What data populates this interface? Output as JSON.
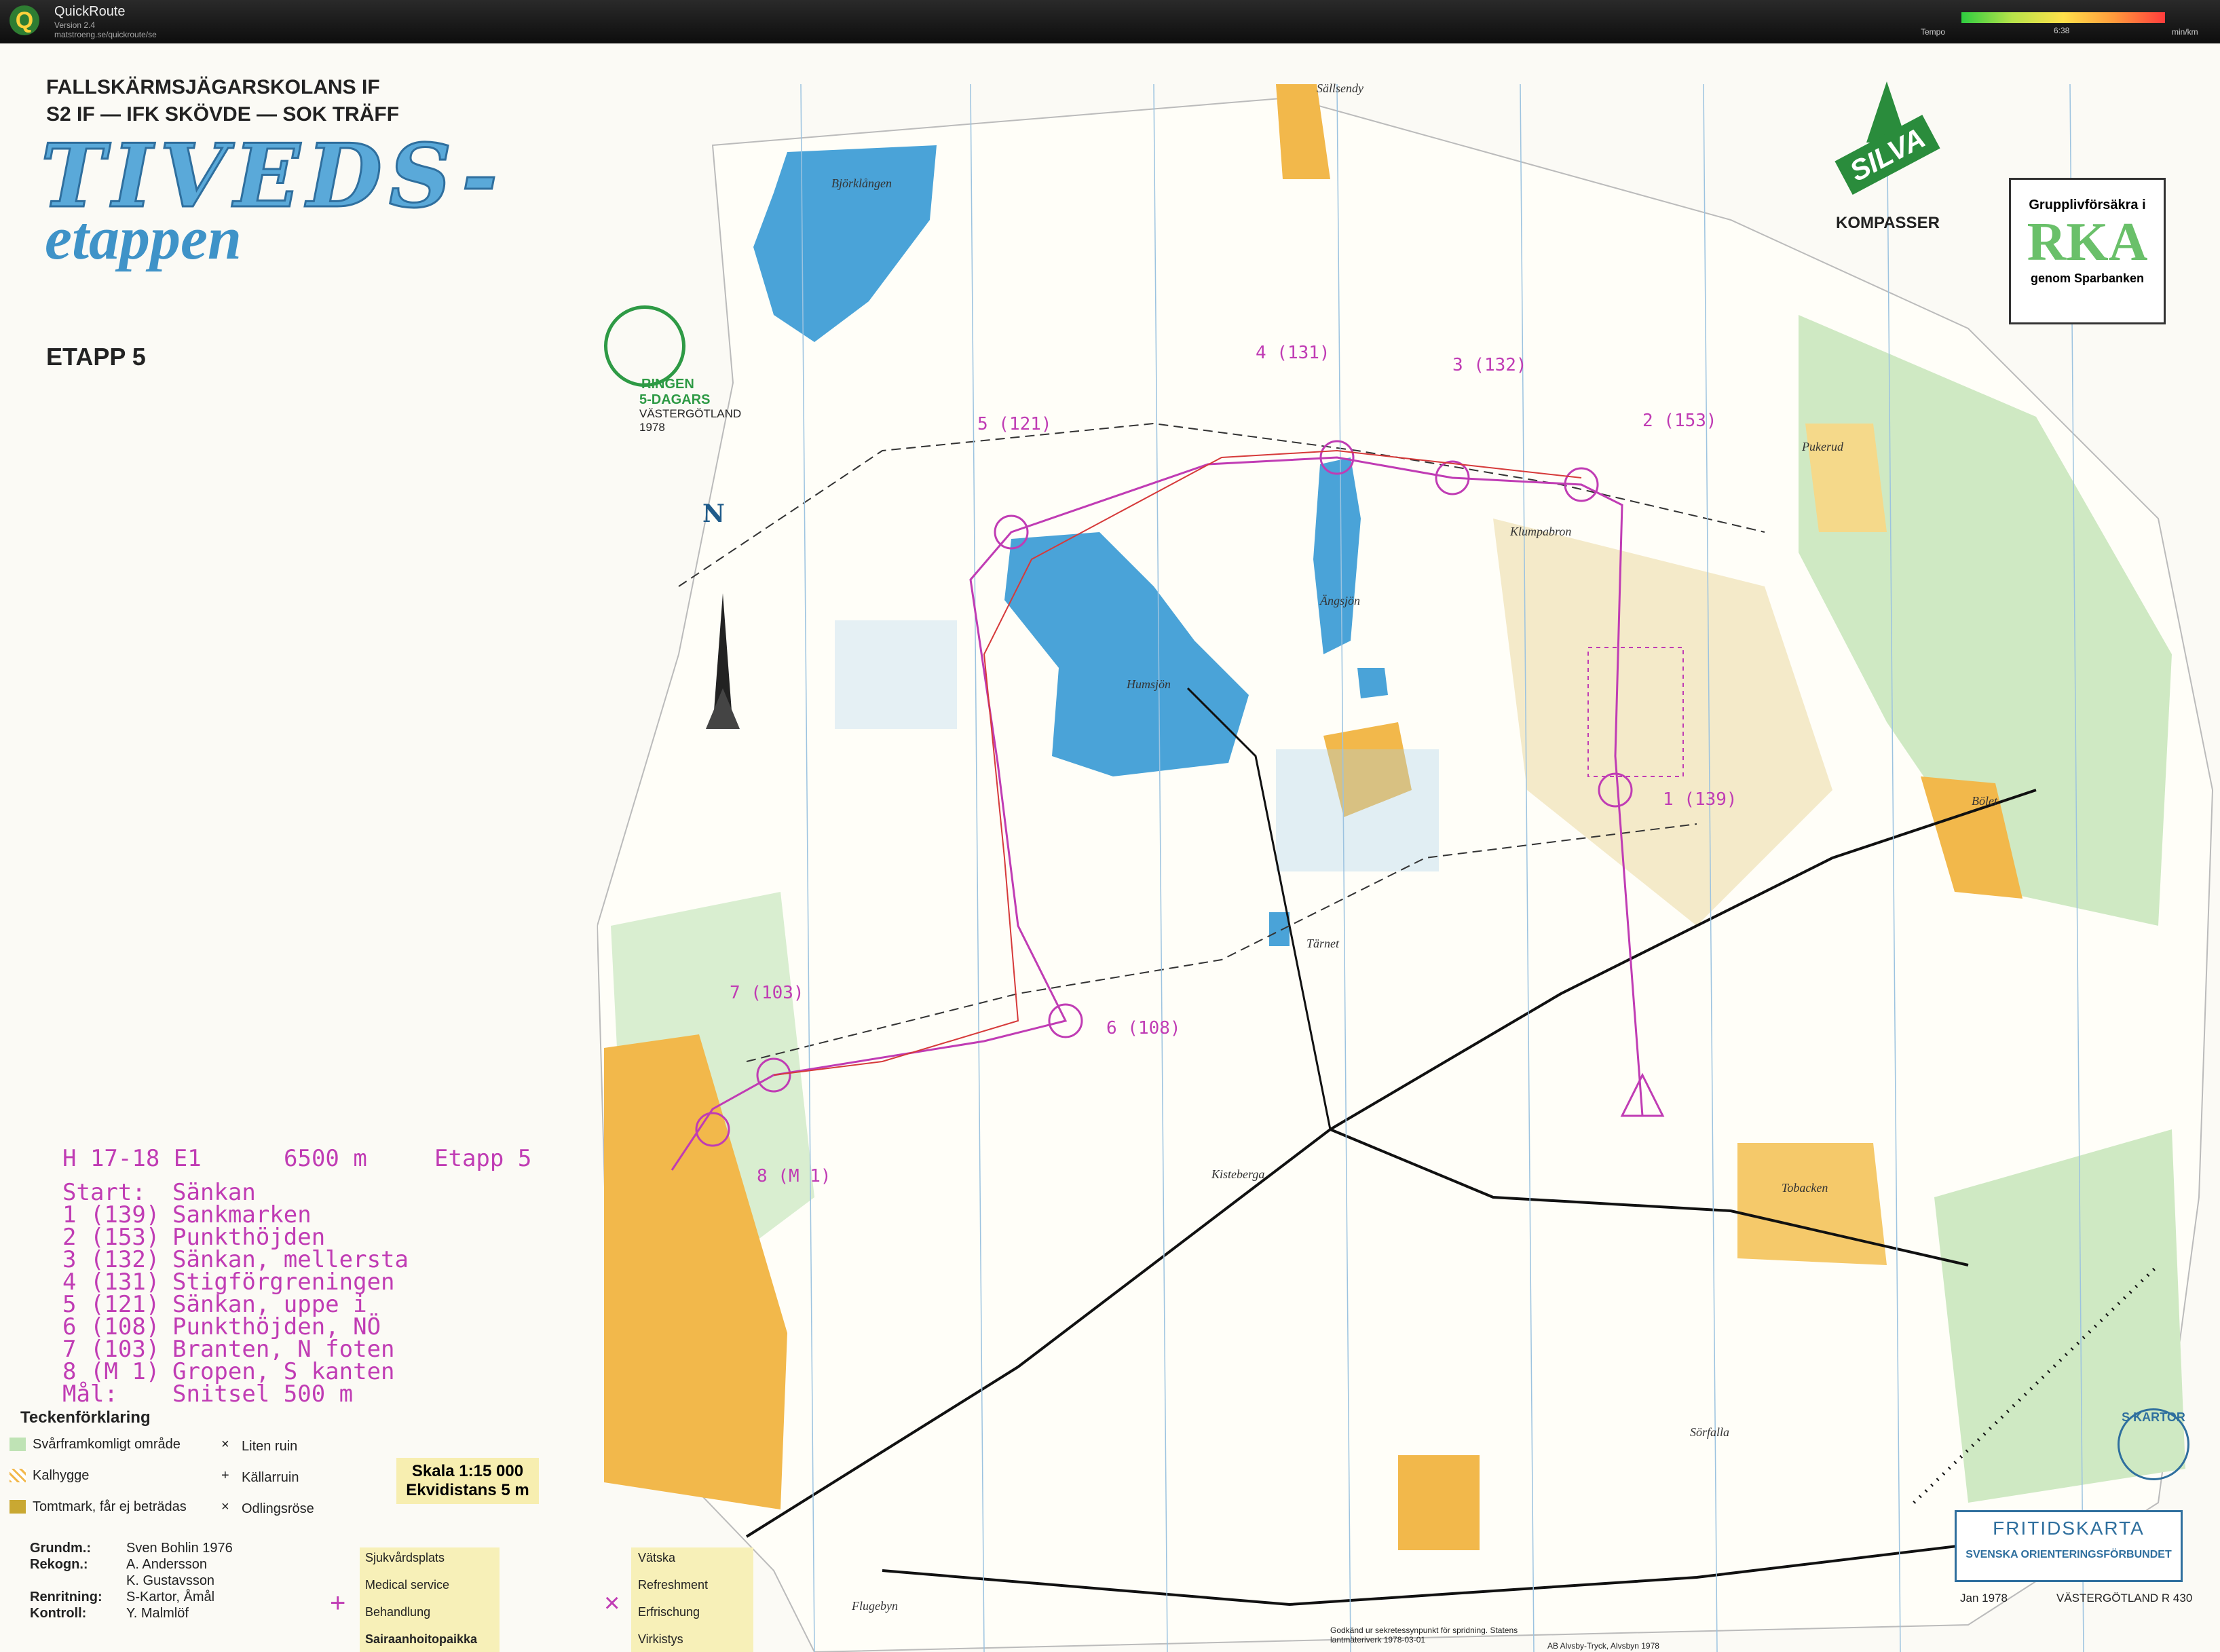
{
  "app": {
    "name": "QuickRoute",
    "version": "Version 2.4",
    "url": "matstroeng.se/quickroute/se"
  },
  "tempo": {
    "label": "Tempo",
    "value": "6:38",
    "unit": "min/km"
  },
  "header": {
    "club_line1": "FALLSKÄRMSJÄGARSKOLANS IF",
    "club_line2": "S2 IF — IFK SKÖVDE — SOK TRÄFF",
    "title": "TIVEDS-",
    "subtitle": "etappen",
    "stage": "ETAPP 5",
    "ringen_line1": "RINGEN",
    "ringen_line2": "5-DAGARS",
    "ringen_line3": "VÄSTERGÖTLAND",
    "ringen_line4": "1978"
  },
  "sponsors": {
    "silva": "SILVA",
    "kompasser": "KOMPASSER",
    "rka_line1": "Grupplivförsäkra i",
    "rka_big": "RKA",
    "rka_line3": "genom Sparbanken"
  },
  "north": "N",
  "course": {
    "header_class": "H 17-18 E1",
    "header_length": "6500 m",
    "header_stage": "Etapp 5",
    "lines": [
      {
        "num": "Start:",
        "desc": "Sänkan"
      },
      {
        "num": "1 (139)",
        "desc": "Sankmarken"
      },
      {
        "num": "2 (153)",
        "desc": "Punkthöjden"
      },
      {
        "num": "3 (132)",
        "desc": "Sänkan, mellersta"
      },
      {
        "num": "4 (131)",
        "desc": "Stigförgreningen"
      },
      {
        "num": "5 (121)",
        "desc": "Sänkan, uppe i"
      },
      {
        "num": "6 (108)",
        "desc": "Punkthöjden, NÖ"
      },
      {
        "num": "7 (103)",
        "desc": "Branten, N foten"
      },
      {
        "num": "8 (M 1)",
        "desc": "Gropen, S kanten"
      },
      {
        "num": "Mål:",
        "desc": "Snitsel 500 m"
      }
    ]
  },
  "map_labels": {
    "bjorklangen": "Björklången",
    "sallsendy": "Sällsendy",
    "humsjon": "Humsjön",
    "angsjon": "Ängsjön",
    "klumpabron": "Klumpabron",
    "pukerud": "Pukerud",
    "bolet": "Bölet",
    "tarnet": "Tärnet",
    "kisteberga": "Kisteberga",
    "tobacken": "Tobacken",
    "sorfalla": "Sörfalla",
    "flugebyn": "Flugebyn"
  },
  "controls": {
    "c1": "1 (139)",
    "c2": "2 (153)",
    "c3": "3 (132)",
    "c4": "4 (131)",
    "c5": "5 (121)",
    "c6": "6 (108)",
    "c7": "7 (103)",
    "c8": "8 (M 1)"
  },
  "legend": {
    "title": "Teckenförklaring",
    "items": [
      "Svårframkomligt område",
      "Kalhygge",
      "Tomtmark, får ej beträdas"
    ],
    "items_right": [
      "Liten ruin",
      "Källarruin",
      "Odlingsröse"
    ]
  },
  "scale": {
    "line1": "Skala 1:15 000",
    "line2": "Ekvidistans 5 m"
  },
  "credits": {
    "grund_label": "Grundm.:",
    "grund_value": "Sven Bohlin 1976",
    "rekogn_label": "Rekogn.:",
    "rekogn_value1": "A. Andersson",
    "rekogn_value2": "K. Gustavsson",
    "renritning_label": "Renritning:",
    "renritning_value": "S-Kartor, Åmål",
    "kontroll_label": "Kontroll:",
    "kontroll_value": "Y. Malmlöf"
  },
  "medical": [
    "Sjukvårdsplats",
    "Medical service",
    "Behandlung",
    "Sairaanhoitopaikka"
  ],
  "refresh": [
    "Vätska",
    "Refreshment",
    "Erfrischung",
    "Virkistys"
  ],
  "fritids": {
    "line1": "FRITIDSKARTA",
    "line2": "SVENSKA ORIENTERINGSFÖRBUNDET",
    "date": "Jan 1978",
    "region": "VÄSTERGÖTLAND R 430"
  },
  "kartor_badge": "S KARTOR",
  "footer_small": "Godkänd ur sekretessynpunkt för spridning. Statens lantmäteriverk 1978-03-01",
  "printer": "AB Alvsby-Tryck, Alvsbyn 1978",
  "colors": {
    "water": "#4aa3d8",
    "course": "#c03cb4",
    "open": "#f2b84b",
    "green": "#bfe3b5"
  }
}
